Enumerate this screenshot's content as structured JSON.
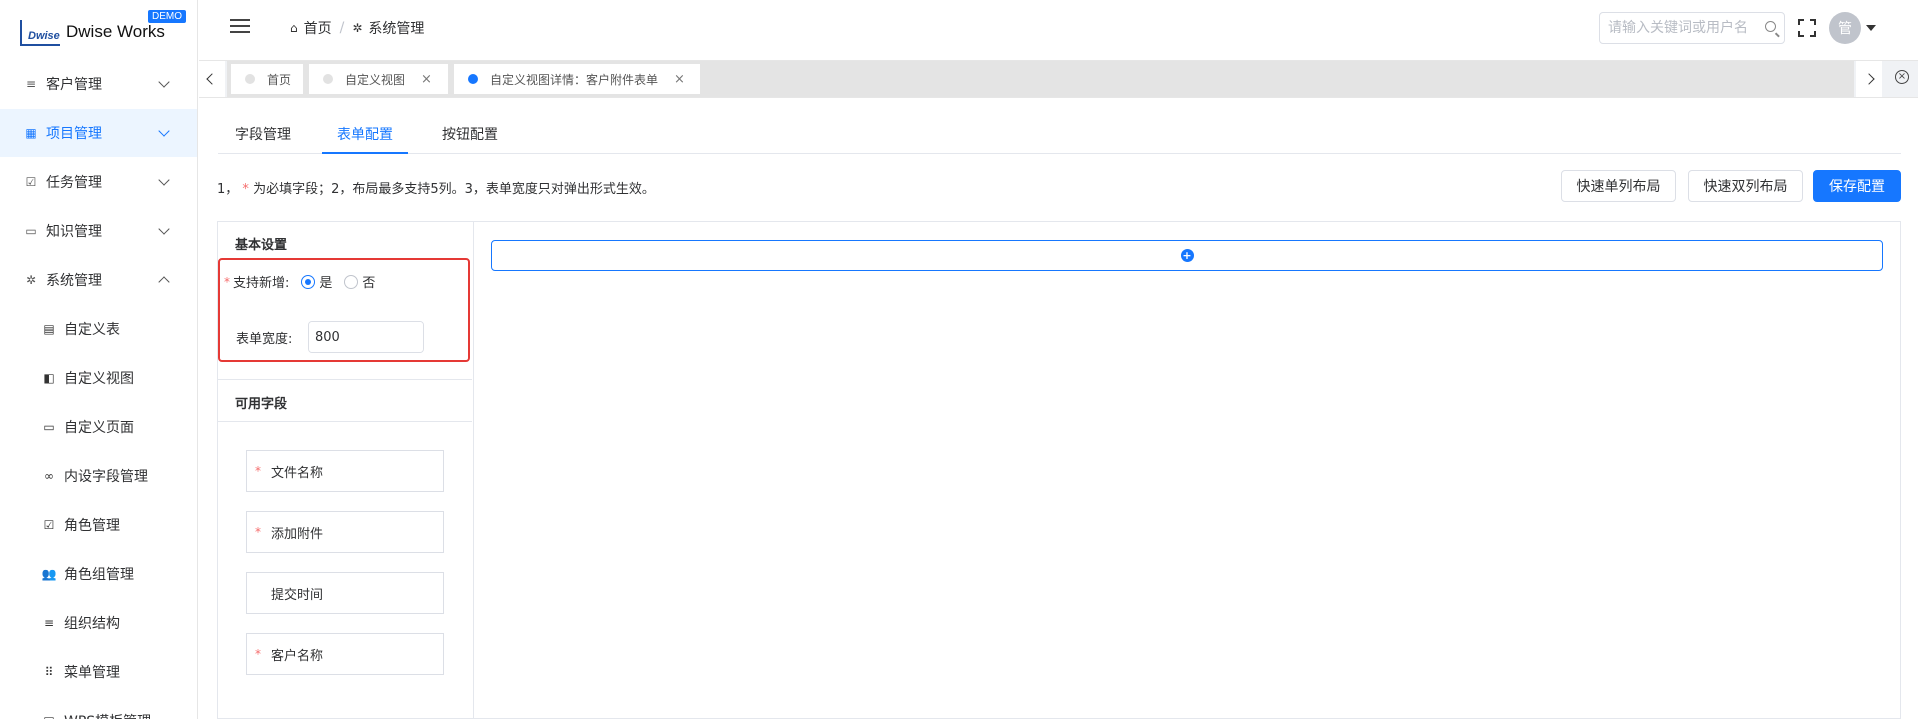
{
  "app": {
    "logo_text": "Dwise Works",
    "logo_mark": "Dwise",
    "badge": "DEMO"
  },
  "sidebar": {
    "items": [
      {
        "label": "客户管理",
        "icon": "list-icon"
      },
      {
        "label": "项目管理",
        "icon": "grid-icon"
      },
      {
        "label": "任务管理",
        "icon": "task-icon"
      },
      {
        "label": "知识管理",
        "icon": "book-icon"
      },
      {
        "label": "系统管理",
        "icon": "gear-icon"
      }
    ],
    "sub_items": [
      {
        "label": "自定义表",
        "icon": "doc-icon"
      },
      {
        "label": "自定义视图",
        "icon": "copy-icon"
      },
      {
        "label": "自定义页面",
        "icon": "window-icon"
      },
      {
        "label": "内设字段管理",
        "icon": "link-icon"
      },
      {
        "label": "角色管理",
        "icon": "checkbox-icon"
      },
      {
        "label": "角色组管理",
        "icon": "group-icon"
      },
      {
        "label": "组织结构",
        "icon": "list-icon"
      },
      {
        "label": "菜单管理",
        "icon": "dots-grid-icon"
      },
      {
        "label": "WPS模板管理",
        "icon": "doc-icon"
      }
    ]
  },
  "header": {
    "breadcrumb": [
      "首页",
      "系统管理"
    ],
    "breadcrumb_sep": "/",
    "search_placeholder": "请输入关键词或用户名",
    "avatar_text": "管"
  },
  "tabs": [
    {
      "label": "首页",
      "closable": false
    },
    {
      "label": "自定义视图",
      "closable": true
    },
    {
      "label": "自定义视图详情：客户附件表单",
      "closable": true
    }
  ],
  "tab_close": "×",
  "sub_tabs": [
    "字段管理",
    "表单配置",
    "按钮配置"
  ],
  "hint": {
    "prefix": "1，",
    "star": "*",
    "text": "为必填字段；2，布局最多支持5列。3，表单宽度只对弹出形式生效。"
  },
  "buttons": {
    "single_col": "快速单列布局",
    "double_col": "快速双列布局",
    "save": "保存配置"
  },
  "basic_settings": {
    "title": "基本设置",
    "support_add_label": "支持新增:",
    "yes": "是",
    "no": "否",
    "form_width_label": "表单宽度:",
    "form_width_value": "800",
    "unit": "px"
  },
  "available_fields": {
    "title": "可用字段",
    "fields": [
      {
        "label": "文件名称",
        "required": true
      },
      {
        "label": "添加附件",
        "required": true
      },
      {
        "label": "提交时间",
        "required": false
      },
      {
        "label": "客户名称",
        "required": true
      }
    ]
  },
  "colors": {
    "accent": "#1677ff",
    "required": "#f56c6c",
    "highlight": "#e53935"
  }
}
